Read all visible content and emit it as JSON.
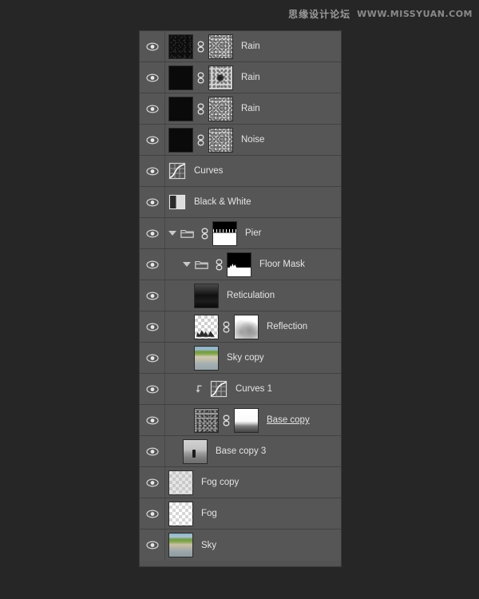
{
  "watermark": {
    "cn_text": "思缘设计论坛",
    "en_text": "WWW.MISSYUAN.COM"
  },
  "panel": {
    "name": "layers-panel",
    "background_color": "#565656",
    "border_color": "#3b3b3b",
    "canvas_color": "#262626",
    "text_color": "#e4e4e4",
    "layers": [
      {
        "name": "Rain",
        "visible": true,
        "indent": 0,
        "type": "pixel",
        "thumb": "t-black-speck",
        "has_link": true,
        "mask_thumb": "t-noise-light",
        "underlined": false
      },
      {
        "name": "Rain",
        "visible": true,
        "indent": 0,
        "type": "pixel",
        "thumb": "t-black",
        "has_link": true,
        "mask_thumb": "t-noise-blob",
        "underlined": false
      },
      {
        "name": "Rain",
        "visible": true,
        "indent": 0,
        "type": "pixel",
        "thumb": "t-black",
        "has_link": true,
        "mask_thumb": "t-noise-light",
        "underlined": false
      },
      {
        "name": "Noise",
        "visible": true,
        "indent": 0,
        "type": "pixel",
        "thumb": "t-black",
        "has_link": true,
        "mask_thumb": "t-noise-light",
        "underlined": false
      },
      {
        "name": "Curves",
        "visible": true,
        "indent": 0,
        "type": "adjustment-curves",
        "underlined": false
      },
      {
        "name": "Black & White",
        "visible": true,
        "indent": 0,
        "type": "adjustment-blackwhite",
        "underlined": false
      },
      {
        "name": "Pier",
        "visible": true,
        "indent": 0,
        "type": "group",
        "expanded": true,
        "has_link": true,
        "mask_thumb": "t-mask-pier",
        "underlined": false
      },
      {
        "name": "Floor Mask",
        "visible": true,
        "indent": 1,
        "type": "group",
        "expanded": true,
        "has_link": true,
        "mask_thumb": "t-mask-floor",
        "underlined": false
      },
      {
        "name": "Reticulation",
        "visible": true,
        "indent": 2,
        "type": "pixel",
        "thumb": "t-retic",
        "has_link": false,
        "underlined": false
      },
      {
        "name": "Reflection",
        "visible": true,
        "indent": 2,
        "type": "pixel",
        "thumb": "t-refl",
        "has_link": true,
        "mask_thumb": "t-white-blur",
        "underlined": false
      },
      {
        "name": "Sky copy",
        "visible": true,
        "indent": 2,
        "type": "pixel",
        "thumb": "t-sky-copy",
        "has_link": false,
        "underlined": false
      },
      {
        "name": "Curves 1",
        "visible": true,
        "indent": 2,
        "type": "adjustment-curves",
        "clipped": true,
        "underlined": false
      },
      {
        "name": "Base copy",
        "visible": true,
        "indent": 2,
        "type": "pixel",
        "thumb": "t-base-noise",
        "has_link": true,
        "mask_thumb": "t-base-mask",
        "underlined": true
      },
      {
        "name": "Base copy 3",
        "visible": true,
        "indent": 1,
        "type": "pixel",
        "thumb": "t-photo-gray",
        "has_link": false,
        "underlined": false
      },
      {
        "name": "Fog copy",
        "visible": true,
        "indent": 0,
        "type": "pixel",
        "thumb": "t-fog-copy",
        "has_link": false,
        "underlined": false
      },
      {
        "name": "Fog",
        "visible": true,
        "indent": 0,
        "type": "pixel",
        "thumb": "t-fog",
        "has_link": false,
        "underlined": false
      },
      {
        "name": "Sky",
        "visible": true,
        "indent": 0,
        "type": "pixel",
        "thumb": "t-sky",
        "has_link": false,
        "underlined": false
      }
    ]
  }
}
